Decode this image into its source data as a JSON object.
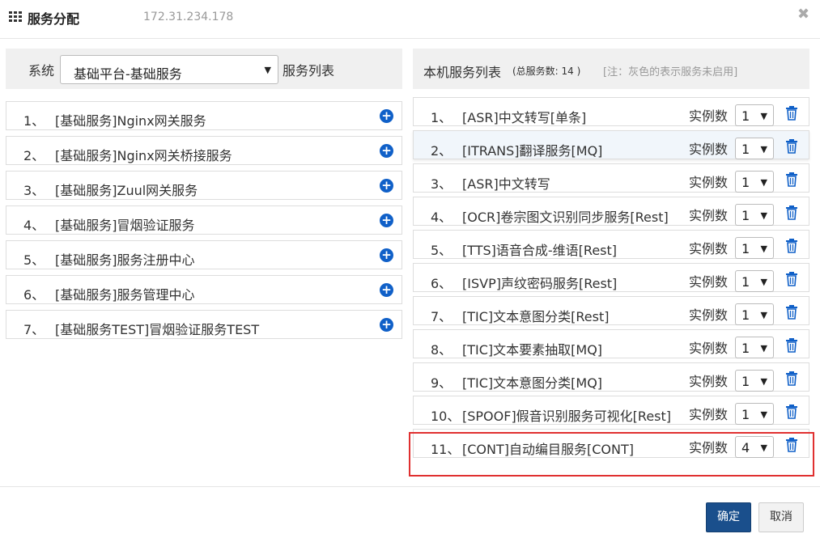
{
  "header": {
    "title": "服务分配",
    "ip": "172.31.234.178",
    "close_glyph": "✖",
    "icon": "grid-icon"
  },
  "left": {
    "system_label": "系统",
    "system_value": "基础平台-基础服务",
    "list_label": "服务列表",
    "items": [
      {
        "num": "1、",
        "name": "[基础服务]Nginx网关服务"
      },
      {
        "num": "2、",
        "name": "[基础服务]Nginx网关桥接服务"
      },
      {
        "num": "3、",
        "name": "[基础服务]Zuul网关服务"
      },
      {
        "num": "4、",
        "name": "[基础服务]冒烟验证服务"
      },
      {
        "num": "5、",
        "name": "[基础服务]服务注册中心"
      },
      {
        "num": "6、",
        "name": "[基础服务]服务管理中心"
      },
      {
        "num": "7、",
        "name": "[基础服务TEST]冒烟验证服务TEST"
      }
    ]
  },
  "right": {
    "title": "本机服务列表",
    "total": "(总服务数: 14 )",
    "note": "[注：灰色的表示服务未启用]",
    "instance_label": "实例数",
    "items": [
      {
        "num": "1、",
        "name": "[ASR]中文转写[单条]",
        "instances": "1"
      },
      {
        "num": "2、",
        "name": "[ITRANS]翻译服务[MQ]",
        "instances": "1"
      },
      {
        "num": "3、",
        "name": "[ASR]中文转写",
        "instances": "1"
      },
      {
        "num": "4、",
        "name": "[OCR]卷宗图文识别同步服务[Rest]",
        "instances": "1"
      },
      {
        "num": "5、",
        "name": "[TTS]语音合成-维语[Rest]",
        "instances": "1"
      },
      {
        "num": "6、",
        "name": "[ISVP]声纹密码服务[Rest]",
        "instances": "1"
      },
      {
        "num": "7、",
        "name": "[TIC]文本意图分类[Rest]",
        "instances": "1"
      },
      {
        "num": "8、",
        "name": "[TIC]文本要素抽取[MQ]",
        "instances": "1"
      },
      {
        "num": "9、",
        "name": "[TIC]文本意图分类[MQ]",
        "instances": "1"
      },
      {
        "num": "10、",
        "name": "[SPOOF]假音识别服务可视化[Rest]",
        "instances": "1"
      },
      {
        "num": "11、",
        "name": "[CONT]自动编目服务[CONT]",
        "instances": "4"
      }
    ]
  },
  "footer": {
    "ok_label": "确定",
    "cancel_label": "取消"
  },
  "colors": {
    "accent": "#1060c8",
    "primary_button": "#1a4f8c",
    "highlight_border": "#e03030"
  }
}
